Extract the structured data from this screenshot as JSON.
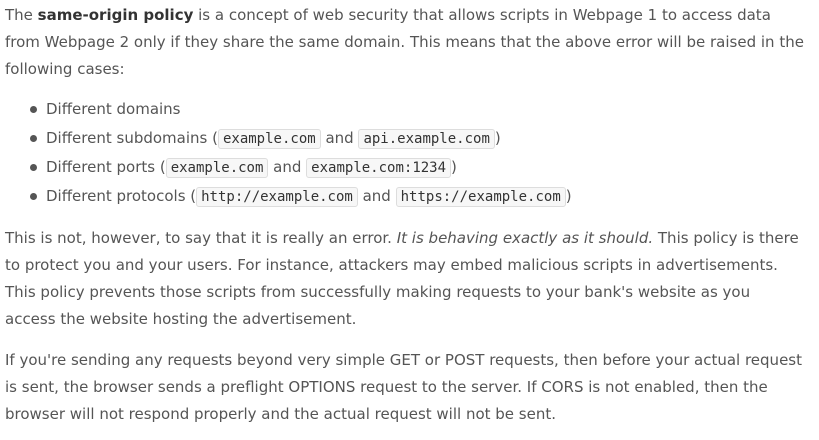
{
  "para1": {
    "lead": "The ",
    "strong": "same-origin policy",
    "rest": " is a concept of web security that allows scripts in Webpage 1 to access data from Webpage 2 only if they share the same domain. This means that the above error will be raised in the following cases:"
  },
  "cases": [
    {
      "text": "Different domains"
    },
    {
      "prefix": "Different subdomains (",
      "code1": "example.com",
      "mid": " and ",
      "code2": "api.example.com",
      "suffix": ")"
    },
    {
      "prefix": "Different ports (",
      "code1": "example.com",
      "mid": " and ",
      "code2": "example.com:1234",
      "suffix": ")"
    },
    {
      "prefix": "Different protocols (",
      "code1": "http://example.com",
      "mid": " and ",
      "code2": "https://example.com",
      "suffix": ")"
    }
  ],
  "para2": {
    "lead": "This is not, however, to say that it is really an error. ",
    "em": "It is behaving exactly as it should.",
    "rest": " This policy is there to protect you and your users. For instance, attackers may embed malicious scripts in advertisements. This policy prevents those scripts from successfully making requests to your bank's website as you access the website hosting the advertisement."
  },
  "para3": {
    "text": "If you're sending any requests beyond very simple GET or POST requests, then before your actual request is sent, the browser sends a preflight OPTIONS request to the server. If CORS is not enabled, then the browser will not respond properly and the actual request will not be sent."
  }
}
